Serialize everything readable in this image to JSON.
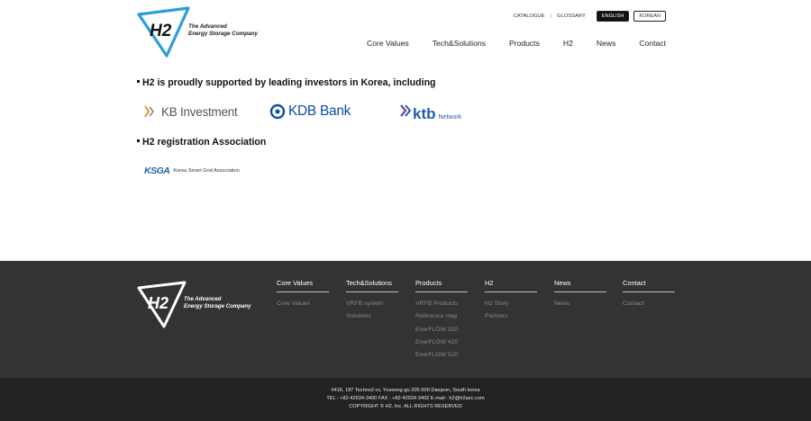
{
  "header": {
    "logo_text": "H2",
    "tagline_line1": "The Advanced",
    "tagline_line2": "Energy Storage Company",
    "util": {
      "catalogue": "CATALOGUE",
      "glossary": "GLOSSARY",
      "english": "ENGLISH",
      "korean": "KOREAN"
    },
    "nav": [
      "Core Values",
      "Tech&Solutions",
      "Products",
      "H2",
      "News",
      "Contact"
    ]
  },
  "main": {
    "investors_title": "H2 is proudly supported by leading investors in Korea, including",
    "investors": {
      "kb": "KB Investment",
      "kdb": "KDB Bank",
      "ktb_main": "ktb",
      "ktb_sub": "Network"
    },
    "association_title": "H2 registration Association",
    "association": {
      "abbr": "KSGA",
      "name": "Korea Smart Grid Association"
    }
  },
  "footer": {
    "columns": [
      {
        "head": "Core Values",
        "items": [
          "Core Values"
        ]
      },
      {
        "head": "Tech&Solutions",
        "items": [
          "VRFB system",
          "Solutions"
        ]
      },
      {
        "head": "Products",
        "items": [
          "VRFB Products",
          "Reference map",
          "EnerFLOW 320",
          "EnerFLOW 420",
          "EnerFLOW 520"
        ]
      },
      {
        "head": "H2",
        "items": [
          "H2 Story",
          "Partners"
        ]
      },
      {
        "head": "News",
        "items": [
          "News"
        ]
      },
      {
        "head": "Contact",
        "items": [
          "Contact"
        ]
      }
    ],
    "address": "#416, 187 Techno2-ro, Yuseong-gu 205-500 Daejeon, South korea",
    "contact": "TEL : +82-42934-3400 FAX : +82-42934-3402 E-mail : h2@h2aec.com",
    "copyright": "COPYRIGHT © H2, Inc. ALL RIGHTS RESERVED"
  },
  "colors": {
    "logo_blue": "#2a9fd6",
    "kb_gold": "#c9a227",
    "kdb_blue": "#0b4ea2",
    "ktb_blue": "#1f5fae",
    "ktb_purple": "#6b4fa0",
    "footer_bg": "#333333",
    "bottom_bg": "#222222"
  }
}
